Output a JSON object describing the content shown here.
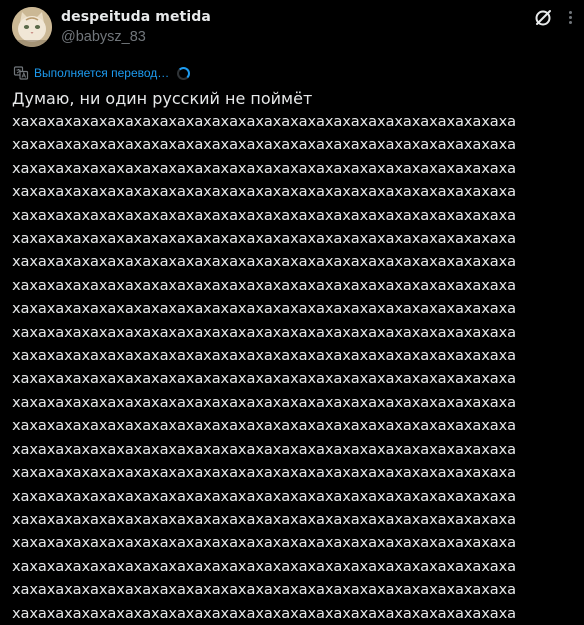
{
  "post": {
    "author": {
      "display_name": "despeituda metida",
      "handle": "@babysz_83",
      "avatar_icon": "cat-avatar"
    },
    "actions": {
      "grok_icon": "grok-icon",
      "more_icon": "more-icon"
    },
    "translation": {
      "status": "Выполняется перевод…",
      "icon": "translate-icon"
    },
    "text": {
      "first_line": "Думаю, ни один русский не поймёт",
      "lines": [
        "хахахахахахахахахахахахахахахахахахахахахахахахахахахахаха",
        "хахахахахахахахахахахахахахахахахахахахахахахахахахахахаха",
        "хахахахахахахахахахахахахахахахахахахахахахахахахахахахаха",
        "хахахахахахахахахахахахахахахахахахахахахахахахахахахахаха",
        "хахахахахахахахахахахахахахахахахахахахахахахахахахахахаха",
        "хахахахахахахахахахахахахахахахахахахахахахахахахахахахаха",
        "хахахахахахахахахахахахахахахахахахахахахахахахахахахахаха",
        "хахахахахахахахахахахахахахахахахахахахахахахахахахахахаха",
        "хахахахахахахахахахахахахахахахахахахахахахахахахахахахаха",
        "хахахахахахахахахахахахахахахахахахахахахахахахахахахахаха",
        "хахахахахахахахахахахахахахахахахахахахахахахахахахахахаха",
        "хахахахахахахахахахахахахахахахахахахахахахахахахахахахаха",
        "хахахахахахахахахахахахахахахахахахахахахахахахахахахахаха",
        "хахахахахахахахахахахахахахахахахахахахахахахахахахахахаха",
        "хахахахахахахахахахахахахахахахахахахахахахахахахахахахаха",
        "хахахахахахахахахахахахахахахахахахахахахахахахахахахахаха",
        "хахахахахахахахахахахахахахахахахахахахахахахахахахахахаха",
        "хахахахахахахахахахахахахахахахахахахахахахахахахахахахаха",
        "хахахахахахахахахахахахахахахахахахахахахахахахахахахахаха",
        "хахахахахахахахахахахахахахахахахахахахахахахахахахахахаха",
        "хахахахахахахахахахахахахахахахахахахахахахахахахахахахаха",
        "хахахахахахахахахахахахахахахахахахахахахахахахахахахахаха"
      ]
    }
  },
  "colors": {
    "background": "#000000",
    "text": "#e7e9ea",
    "secondary": "#71767b",
    "accent": "#1d9bf0"
  }
}
